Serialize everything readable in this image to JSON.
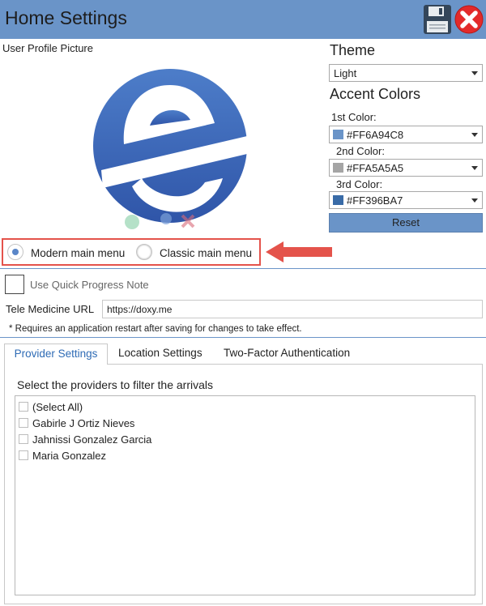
{
  "window": {
    "title": "Home Settings",
    "icons": [
      "floppy-save-icon",
      "close-icon"
    ],
    "accent": "#6A94C8"
  },
  "profile": {
    "label": "User Profile Picture"
  },
  "theme": {
    "heading": "Theme",
    "selected": "Light"
  },
  "accent_colors": {
    "heading": "Accent Colors",
    "items": [
      {
        "label": "1st Color:",
        "value": "#FF6A94C8",
        "swatch": "#6A94C8"
      },
      {
        "label": "2nd Color:",
        "value": "#FFA5A5A5",
        "swatch": "#A5A5A5"
      },
      {
        "label": "3rd Color:",
        "value": "#FF396BA7",
        "swatch": "#396BA7"
      }
    ],
    "reset_label": "Reset"
  },
  "menu_style": {
    "modern_label": "Modern main menu",
    "classic_label": "Classic main menu",
    "selected": "modern"
  },
  "quick_progress": {
    "label": "Use Quick Progress Note",
    "checked": false
  },
  "tele_medicine": {
    "label": "Tele Medicine URL",
    "value": "https://doxy.me"
  },
  "restart_note": "* Requires an application restart after saving for changes to take effect.",
  "tabs": [
    {
      "label": "Provider Settings",
      "active": true
    },
    {
      "label": "Location Settings",
      "active": false
    },
    {
      "label": "Two-Factor Authentication",
      "active": false
    }
  ],
  "providers": {
    "heading": "Select the providers to filter the arrivals",
    "items": [
      "(Select All)",
      "Gabirle J Ortiz Nieves",
      "Jahnissi Gonzalez Garcia",
      "Maria Gonzalez"
    ]
  }
}
